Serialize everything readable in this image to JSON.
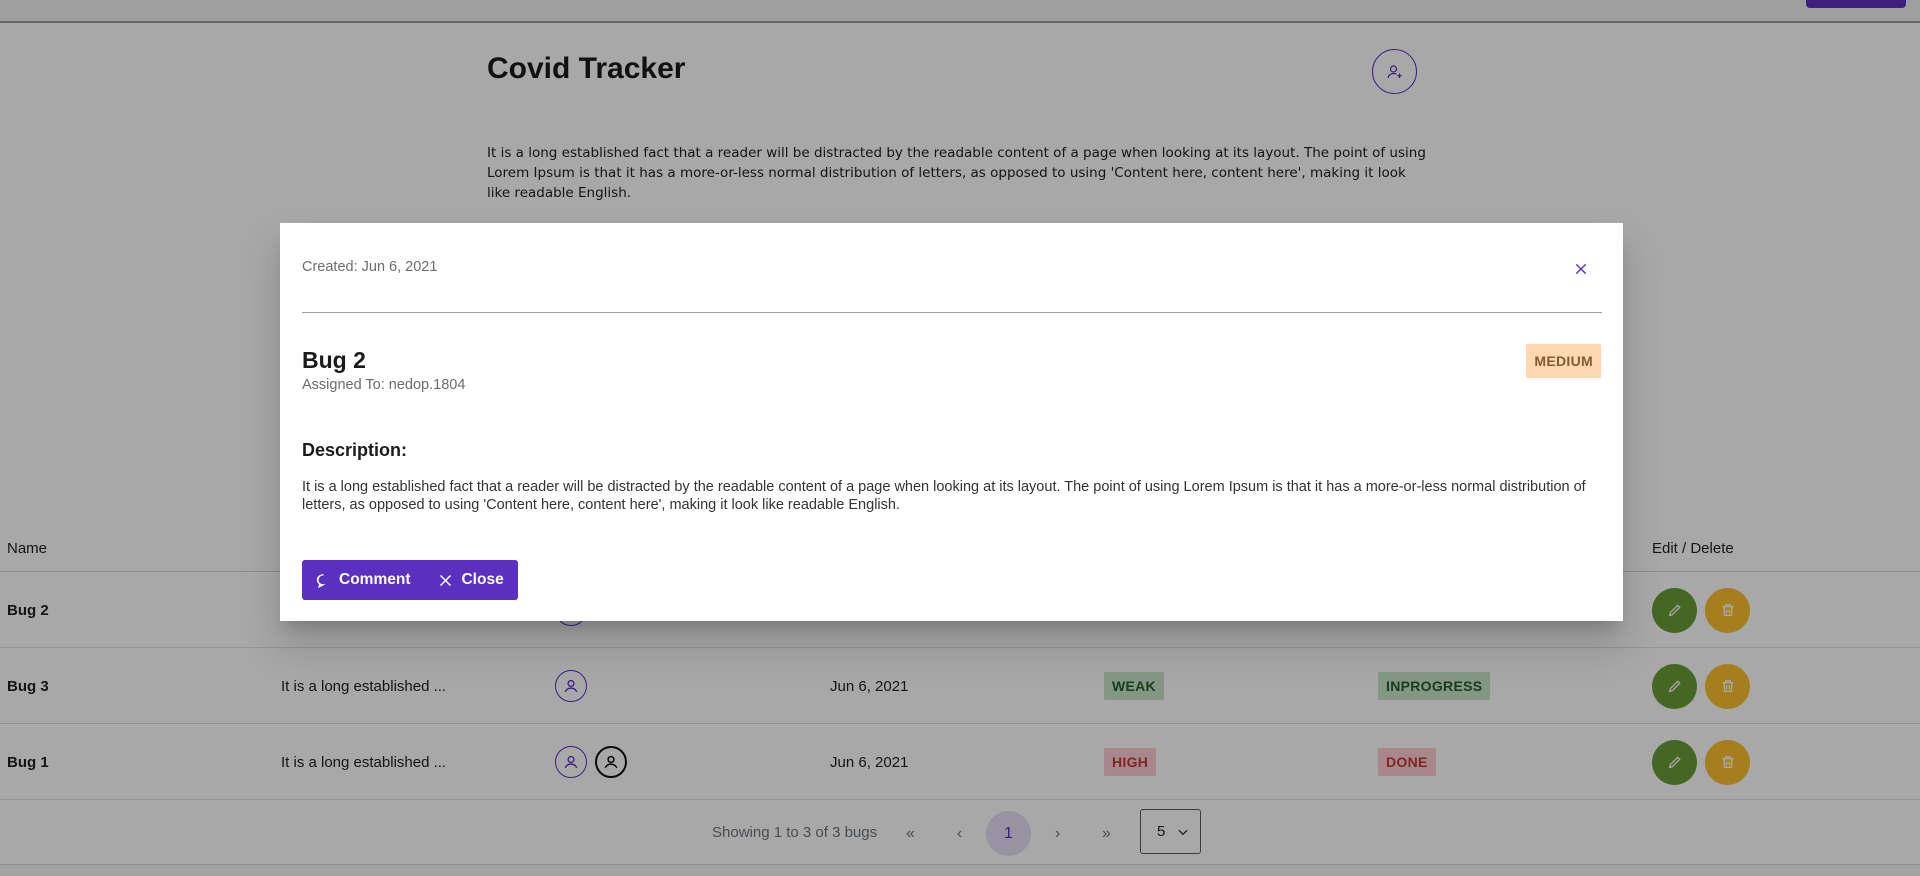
{
  "project": {
    "title": "Covid Tracker",
    "description": "It is a long established fact that a reader will be distracted by the readable content of a page when looking at its layout. The point of using Lorem Ipsum is that it has a more-or-less normal distribution of letters, as opposed to using 'Content here, content here', making it look like readable English."
  },
  "table": {
    "columns": {
      "name": "Name",
      "actions": "Edit / Delete"
    },
    "rows": [
      {
        "name": "Bug 2",
        "description": "",
        "date": "",
        "priority": "",
        "status": ""
      },
      {
        "name": "Bug 3",
        "description": "It is a long established ...",
        "date": "Jun 6, 2021",
        "priority": "WEAK",
        "status": "INPROGRESS"
      },
      {
        "name": "Bug 1",
        "description": "It is a long established ...",
        "date": "Jun 6, 2021",
        "priority": "HIGH",
        "status": "DONE"
      }
    ]
  },
  "pagination": {
    "summary": "Showing 1 to 3 of 3 bugs",
    "first": "«",
    "prev": "‹",
    "current": "1",
    "next": "›",
    "last": "»",
    "rows_per_page": "5"
  },
  "dialog": {
    "created": "Created: Jun 6, 2021",
    "title": "Bug 2",
    "assigned": "Assigned To: nedop.1804",
    "priority": "MEDIUM",
    "description_heading": "Description:",
    "description": "It is a long established fact that a reader will be distracted by the readable content of a page when looking at its layout. The point of using Lorem Ipsum is that it has a more-or-less normal distribution of letters, as opposed to using 'Content here, content here', making it look like readable English.",
    "comment_label": "Comment",
    "close_label": "Close"
  },
  "colors": {
    "primary": "#5b2fc0",
    "edit": "#689f38",
    "delete": "#fbc02d",
    "medium_bg": "#ffd8b2",
    "weak_bg": "#c8e6c9",
    "high_bg": "#ffcdd2"
  },
  "icons": {
    "add_member": "user-plus-icon",
    "avatar": "user-circle-icon",
    "edit": "pencil-icon",
    "delete": "trash-icon",
    "comment": "comment-icon",
    "close": "close-icon",
    "dropdown": "chevron-down-icon"
  }
}
